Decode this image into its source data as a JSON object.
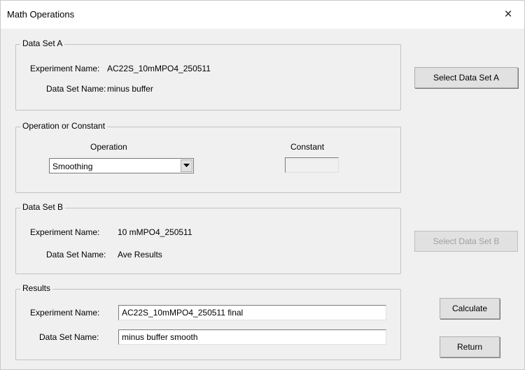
{
  "window": {
    "title": "Math Operations",
    "close_glyph": "×"
  },
  "data_set_a": {
    "legend": "Data Set A",
    "experiment_label": "Experiment Name:",
    "experiment_value": "AC22S_10mMPO4_250511",
    "dataset_label": "Data Set Name:",
    "dataset_value": "minus buffer"
  },
  "operation": {
    "legend": "Operation or Constant",
    "operation_label": "Operation",
    "operation_value": "Smoothing",
    "constant_label": "Constant",
    "constant_value": ""
  },
  "data_set_b": {
    "legend": "Data Set B",
    "experiment_label": "Experiment Name:",
    "experiment_value": "10 mMPO4_250511",
    "dataset_label": "Data Set Name:",
    "dataset_value": "Ave Results"
  },
  "results": {
    "legend": "Results",
    "experiment_label": "Experiment Name:",
    "experiment_value": "AC22S_10mMPO4_250511 final",
    "dataset_label": "Data Set Name:",
    "dataset_value": "minus buffer smooth"
  },
  "buttons": {
    "select_a": "Select Data Set A",
    "select_b": "Select Data Set B",
    "calculate": "Calculate",
    "return": "Return"
  },
  "icons": {
    "close": "close-icon",
    "dropdown": "chevron-down-icon"
  }
}
